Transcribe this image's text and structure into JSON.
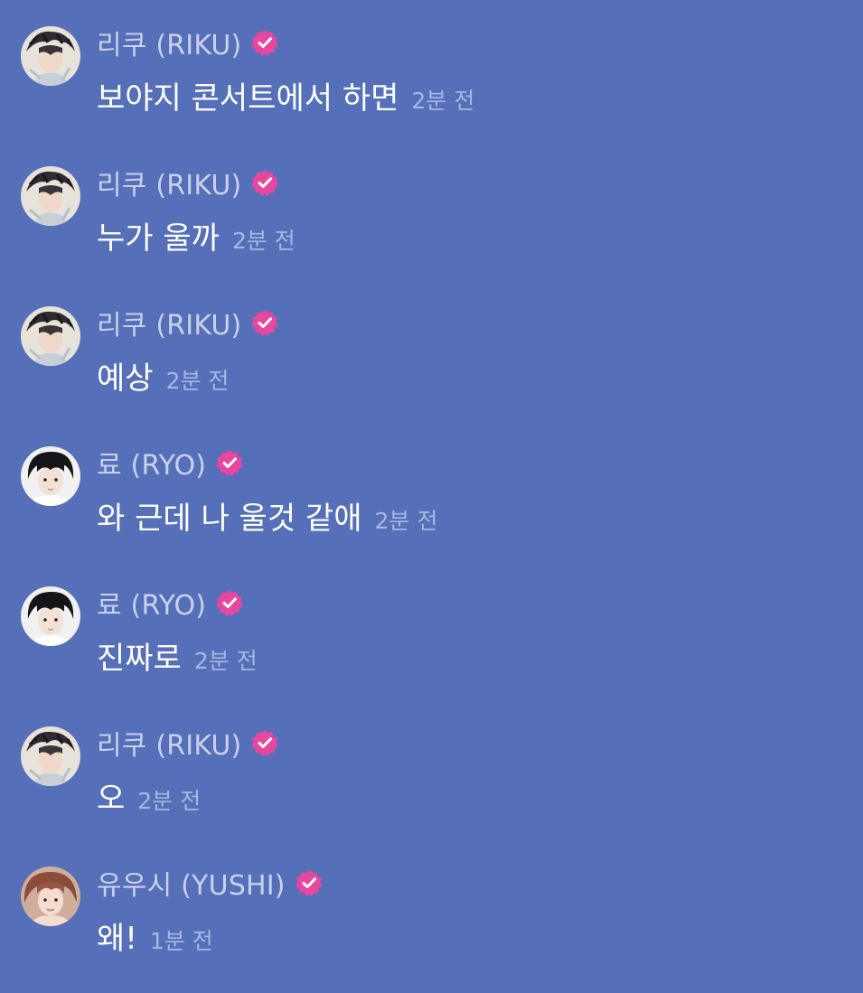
{
  "colors": {
    "background": "#5570b8",
    "name": "#c9d1ec",
    "message": "#ffffff",
    "time": "#a9b6e2",
    "verified_badge": "#e8479f"
  },
  "messages": [
    {
      "avatar": "riku",
      "author": "리쿠 (RIKU)",
      "verified": true,
      "text": "보야지 콘서트에서 하면",
      "time": "2분 전"
    },
    {
      "avatar": "riku",
      "author": "리쿠 (RIKU)",
      "verified": true,
      "text": "누가 울까",
      "time": "2분 전"
    },
    {
      "avatar": "riku",
      "author": "리쿠 (RIKU)",
      "verified": true,
      "text": "예상",
      "time": "2분 전"
    },
    {
      "avatar": "ryo",
      "author": "료 (RYO)",
      "verified": true,
      "text": "와 근데 나 울것 같애",
      "time": "2분 전"
    },
    {
      "avatar": "ryo",
      "author": "료 (RYO)",
      "verified": true,
      "text": "진짜로",
      "time": "2분 전"
    },
    {
      "avatar": "riku",
      "author": "리쿠 (RIKU)",
      "verified": true,
      "text": "오",
      "time": "2분 전"
    },
    {
      "avatar": "yushi",
      "author": "유우시 (YUSHI)",
      "verified": true,
      "text": "왜!",
      "time": "1분 전"
    }
  ],
  "icons": {
    "verified": "verified-badge-icon",
    "avatar_riku": "avatar-riku",
    "avatar_ryo": "avatar-ryo",
    "avatar_yushi": "avatar-yushi"
  }
}
